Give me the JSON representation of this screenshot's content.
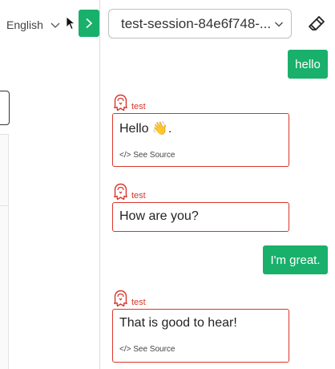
{
  "language": {
    "selected": "English"
  },
  "session": {
    "selected": "test-session-84e6f748-..."
  },
  "messages": [
    {
      "role": "user",
      "text": "hello"
    },
    {
      "role": "bot",
      "author": "test",
      "text": "Hello 👋.",
      "source_link": "</> See Source"
    },
    {
      "role": "bot",
      "author": "test",
      "text": "How are you?"
    },
    {
      "role": "user",
      "text": "I'm great."
    },
    {
      "role": "bot",
      "author": "test",
      "text": "That is good to hear!",
      "source_link": "</> See Source"
    }
  ],
  "colors": {
    "accent": "#19b06b",
    "bot": "#d9352a"
  },
  "icons": {
    "toggle": "chevron-right-icon",
    "clear": "eraser-icon",
    "avatar": "bot-avatar-icon"
  }
}
